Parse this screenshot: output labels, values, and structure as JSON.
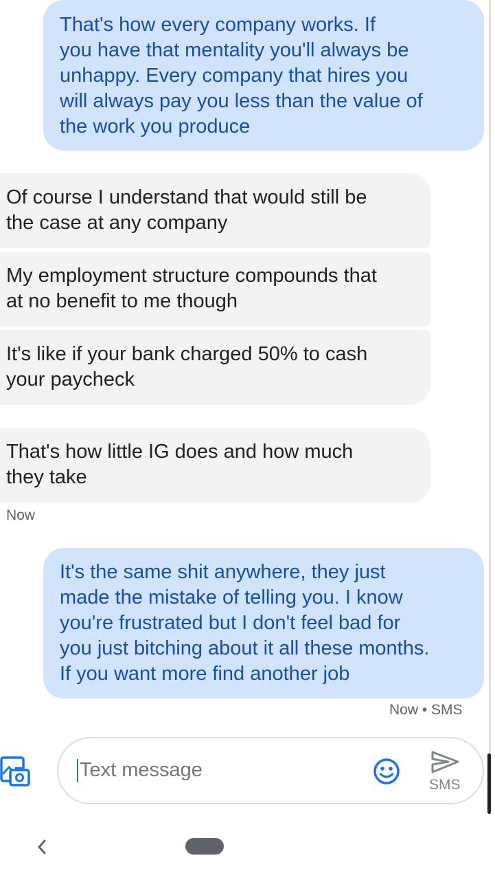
{
  "messages": [
    {
      "direction": "outgoing",
      "text": "That's how every company works. If\nyou have that mentality you'll always be\nunhappy. Every company that hires you\nwill always pay you less than the value of\nthe work you produce"
    },
    {
      "direction": "incoming",
      "text": "Of course I understand that would still be\nthe case at any company"
    },
    {
      "direction": "incoming",
      "text": "My employment structure compounds that\nat no benefit to me though"
    },
    {
      "direction": "incoming",
      "text": "It's like if your bank charged 50% to cash\nyour paycheck"
    },
    {
      "direction": "incoming",
      "text": "That's how little IG does and how much\nthey take"
    },
    {
      "direction": "outgoing",
      "text": "It's the same shit anywhere, they just\nmade the mistake of telling you. I know\nyou're frustrated but I don't feel bad for\nyou just bitching about it all these months.\nIf you want more find another job"
    }
  ],
  "timestamps": {
    "incoming_group": "Now",
    "outgoing_last": "Now • SMS"
  },
  "compose": {
    "placeholder": "Text message",
    "send_label": "SMS"
  },
  "icons": {
    "attach": "attach-media-icon",
    "emoji": "emoji-icon",
    "send": "send-icon",
    "back": "nav-back-icon",
    "home": "nav-home-pill"
  },
  "colors": {
    "outgoing_bubble": "#d2e3fc",
    "outgoing_text": "#174ea6",
    "incoming_bubble": "#f1f3f4",
    "incoming_text": "#202124",
    "accent": "#1a73e8"
  }
}
